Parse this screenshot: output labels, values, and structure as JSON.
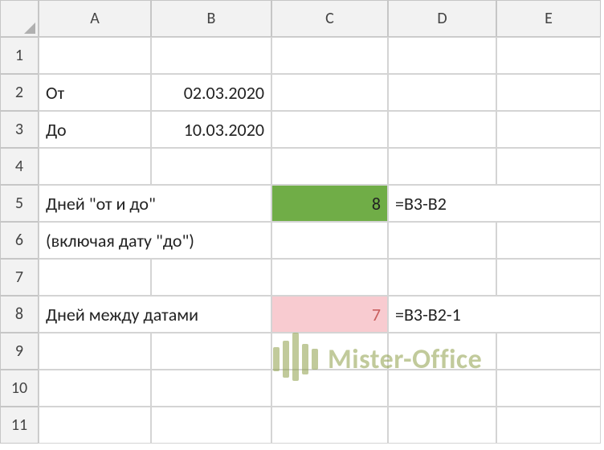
{
  "columns": [
    "A",
    "B",
    "C",
    "D",
    "E"
  ],
  "rows": [
    "1",
    "2",
    "3",
    "4",
    "5",
    "6",
    "7",
    "8",
    "9",
    "10",
    "11"
  ],
  "cells": {
    "A2": "От",
    "B2": "02.03.2020",
    "A3": "До",
    "B3": "10.03.2020",
    "A5": "Дней \"от и до\"",
    "C5": "8",
    "D5": "=B3-B2",
    "A6": "(включая дату \"до\")",
    "A8": "Дней между датами",
    "C8": "7",
    "D8": "=B3-B2-1"
  },
  "watermark": {
    "text": "Mister-Office"
  },
  "chart_data": null
}
